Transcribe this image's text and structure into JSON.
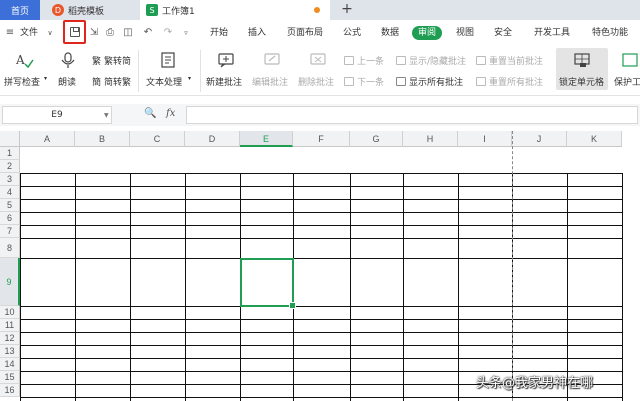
{
  "tabs": {
    "home": "首页",
    "template": "稻壳模板",
    "sheet": "工作簿1",
    "add": "+"
  },
  "menu": {
    "file": "文件",
    "items": [
      "开始",
      "插入",
      "页面布局",
      "公式",
      "数据",
      "审阅",
      "视图",
      "安全",
      "开发工具",
      "特色功能"
    ],
    "active": "审阅"
  },
  "ribbon": {
    "spell_check": "拼写检查",
    "read_aloud": "朗读",
    "trad_to_simp": "繁转简",
    "simp_to_trad": "简转繁",
    "text_process": "文本处理",
    "new_comment": "新建批注",
    "edit_comment": "编辑批注",
    "delete_comment": "删除批注",
    "prev": "上一条",
    "next": "下一条",
    "show_hide_comment": "显示/隐藏批注",
    "show_all_comments": "显示所有批注",
    "reset_current_comment": "重置当前批注",
    "reset_all_comments": "重置所有批注",
    "lock_cell": "锁定单元格",
    "protect_sheet": "保护工"
  },
  "formula_bar": {
    "cell_ref": "E9",
    "fx": "fx",
    "value": ""
  },
  "grid": {
    "columns": [
      "A",
      "B",
      "C",
      "D",
      "E",
      "F",
      "G",
      "H",
      "I",
      "J",
      "K"
    ],
    "rows": [
      "1",
      "2",
      "3",
      "4",
      "5",
      "6",
      "7",
      "8",
      "9",
      "10",
      "11",
      "12",
      "13",
      "14",
      "15",
      "16"
    ],
    "selected_column": "E",
    "selected_row": "9"
  },
  "watermark": "头条@我家男神在哪",
  "colors": {
    "accent_green": "#1f9e53",
    "home_tab_blue": "#3d6fd8",
    "highlight_red": "#e0261c"
  }
}
